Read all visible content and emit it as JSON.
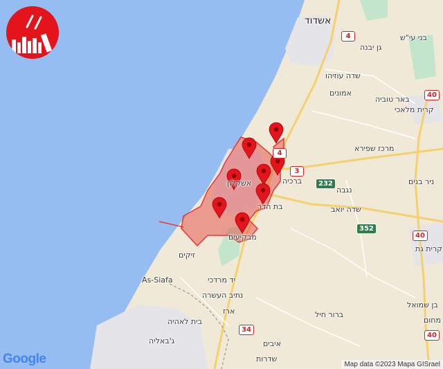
{
  "places": [
    {
      "label": "אשדוד",
      "kind": "city"
    },
    {
      "label": "בני עי\"ש"
    },
    {
      "label": "גן יבנה"
    },
    {
      "label": "שדה עוזיהו"
    },
    {
      "label": "אמונים"
    },
    {
      "label": "באר טוביה"
    },
    {
      "label": "קרית מלאכי"
    },
    {
      "label": "מרכז שפירא"
    },
    {
      "label": "ניר בנים"
    },
    {
      "label": "ברכיה"
    },
    {
      "label": "נגבה"
    },
    {
      "label": "שדה יואב"
    },
    {
      "label": "אשקלון"
    },
    {
      "label": "בת הדר"
    },
    {
      "label": "מבקיעים"
    },
    {
      "label": "קרית גת"
    },
    {
      "label": "זיקים"
    },
    {
      "label": "As-Siafa",
      "ltr": true
    },
    {
      "label": "יד מרדכי"
    },
    {
      "label": "נתיב העשרה"
    },
    {
      "label": "בן שמואל"
    },
    {
      "label": "בית לאהיה"
    },
    {
      "label": "ארז"
    },
    {
      "label": "ברור חיל"
    },
    {
      "label": "מחום"
    },
    {
      "label": "ג'באליה"
    },
    {
      "label": "איבים"
    },
    {
      "label": "שדרות"
    }
  ],
  "road_shields": [
    {
      "label": "4",
      "color": "red"
    },
    {
      "label": "40",
      "color": "red"
    },
    {
      "label": "4",
      "color": "red"
    },
    {
      "label": "3",
      "color": "red"
    },
    {
      "label": "232",
      "color": "green"
    },
    {
      "label": "352",
      "color": "green"
    },
    {
      "label": "40",
      "color": "red"
    },
    {
      "label": "34",
      "color": "red"
    },
    {
      "label": "40",
      "color": "red"
    }
  ],
  "alert_markers": 9,
  "alert_zone_color": "#e53935",
  "logo": {
    "text": "Google"
  },
  "attribution": "Map data ©2023 Mapa GISrael",
  "colors": {
    "sea": "#96bdf2",
    "land": "#f1e9d7",
    "urban": "#e6e6ea",
    "green": "#bfe2c7",
    "highway": "#f7d46e",
    "marker": "#e3141b"
  }
}
